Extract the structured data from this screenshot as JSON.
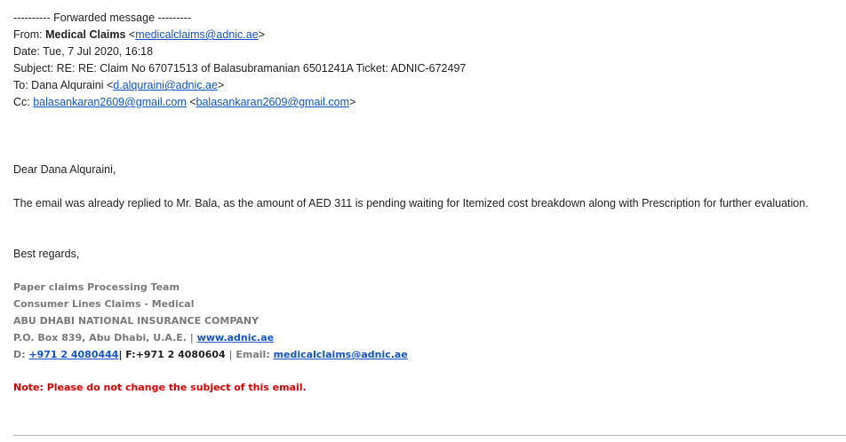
{
  "forward_header": "---------- Forwarded message ---------",
  "from": {
    "label": "From:",
    "name": "Medical Claims",
    "email": "medicalclaims@adnic.ae"
  },
  "date": {
    "label": "Date:",
    "value": "Tue, 7 Jul 2020, 16:18"
  },
  "subject": {
    "label": "Subject:",
    "value": "RE: RE: Claim No 67071513 of Balasubramanian 6501241A Ticket: ADNIC-672497"
  },
  "to": {
    "label": "To:",
    "name": "Dana Alquraini",
    "email": "d.alquraini@adnic.ae"
  },
  "cc": {
    "label": "Cc:",
    "name": "balasankaran2609@gmail.com",
    "email": "balasankaran2609@gmail.com"
  },
  "greeting": "Dear Dana Alquraini,",
  "message": "The email was already replied to Mr. Bala, as the amount of AED 311 is pending waiting for Itemized cost breakdown along with Prescription for further evaluation.",
  "closing": "Best regards,",
  "signature": {
    "team": "Paper claims Processing Team",
    "department": "Consumer Lines Claims - Medical",
    "company": "ABU DHABI NATIONAL INSURANCE COMPANY",
    "address": "P.O. Box 839, Abu Dhabi, U.A.E. |",
    "website": "www.adnic.ae",
    "phone_label": "D:",
    "phone": "+971 2 4080444",
    "fax": "| F:+971 2 4080604",
    "email_label": "| Email:",
    "email": "medicalclaims@adnic.ae"
  },
  "note": "Note: Please do not change the subject of this email.",
  "colors": {
    "link": "#1155cc",
    "signature": "#7a7a7a",
    "note": "#e00000",
    "text": "#222222"
  }
}
